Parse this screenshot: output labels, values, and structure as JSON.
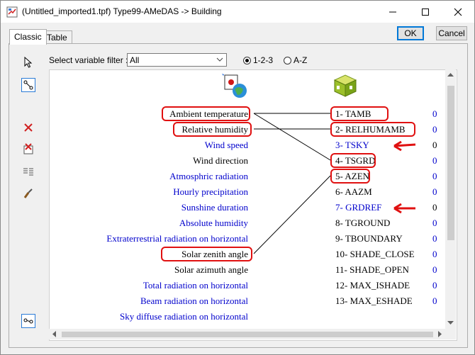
{
  "window": {
    "title": "(Untitled_imported1.tpf) Type99-AMeDAS -> Building"
  },
  "tabs": [
    {
      "label": "Classic"
    },
    {
      "label": "Table"
    }
  ],
  "buttons": {
    "ok": "OK",
    "cancel": "Cancel"
  },
  "filter": {
    "label": "Select variable filter :",
    "value": "All"
  },
  "sort": {
    "option1": "1-2-3",
    "option2": "A-Z",
    "selected": "1-2-3"
  },
  "left_vars": [
    {
      "label": "Ambient temperature",
      "color": "#000000"
    },
    {
      "label": "Relative humidity",
      "color": "#000000"
    },
    {
      "label": "Wind speed",
      "color": "#0000cc"
    },
    {
      "label": "Wind direction",
      "color": "#000000"
    },
    {
      "label": "Atmosphric radiation",
      "color": "#0000cc"
    },
    {
      "label": "Hourly precipitation",
      "color": "#0000cc"
    },
    {
      "label": "Sunshine duration",
      "color": "#0000cc"
    },
    {
      "label": "Absolute humidity",
      "color": "#0000cc"
    },
    {
      "label": "Extraterrestrial radiation on horizontal",
      "color": "#0000cc"
    },
    {
      "label": "Solar zenith angle",
      "color": "#000000"
    },
    {
      "label": "Solar azimuth angle",
      "color": "#000000"
    },
    {
      "label": "Total radiation on horizontal",
      "color": "#0000cc"
    },
    {
      "label": "Beam radiation on horizontal",
      "color": "#0000cc"
    },
    {
      "label": "Sky diffuse radiation on horizontal",
      "color": "#0000cc"
    }
  ],
  "right_vars": [
    {
      "label": "1- TAMB",
      "value": "0",
      "label_color": "#000000",
      "value_color": "#0000cc"
    },
    {
      "label": "2- RELHUMAMB",
      "value": "0",
      "label_color": "#000000",
      "value_color": "#0000cc"
    },
    {
      "label": "3- TSKY",
      "value": "0",
      "label_color": "#0000cc",
      "value_color": "#000000"
    },
    {
      "label": "4- TSGRD",
      "value": "0",
      "label_color": "#000000",
      "value_color": "#0000cc"
    },
    {
      "label": "5- AZEN",
      "value": "0",
      "label_color": "#000000",
      "value_color": "#0000cc"
    },
    {
      "label": "6- AAZM",
      "value": "0",
      "label_color": "#000000",
      "value_color": "#0000cc"
    },
    {
      "label": "7- GRDREF",
      "value": "0",
      "label_color": "#0000cc",
      "value_color": "#000000"
    },
    {
      "label": "8- TGROUND",
      "value": "0",
      "label_color": "#000000",
      "value_color": "#0000cc"
    },
    {
      "label": "9- TBOUNDARY",
      "value": "0",
      "label_color": "#000000",
      "value_color": "#0000cc"
    },
    {
      "label": "10- SHADE_CLOSE",
      "value": "0",
      "label_color": "#000000",
      "value_color": "#0000cc"
    },
    {
      "label": "11- SHADE_OPEN",
      "value": "0",
      "label_color": "#000000",
      "value_color": "#0000cc"
    },
    {
      "label": "12- MAX_ISHADE",
      "value": "0",
      "label_color": "#000000",
      "value_color": "#0000cc"
    },
    {
      "label": "13- MAX_ESHADE",
      "value": "0",
      "label_color": "#000000",
      "value_color": "#0000cc"
    }
  ],
  "accent": "#e01010"
}
